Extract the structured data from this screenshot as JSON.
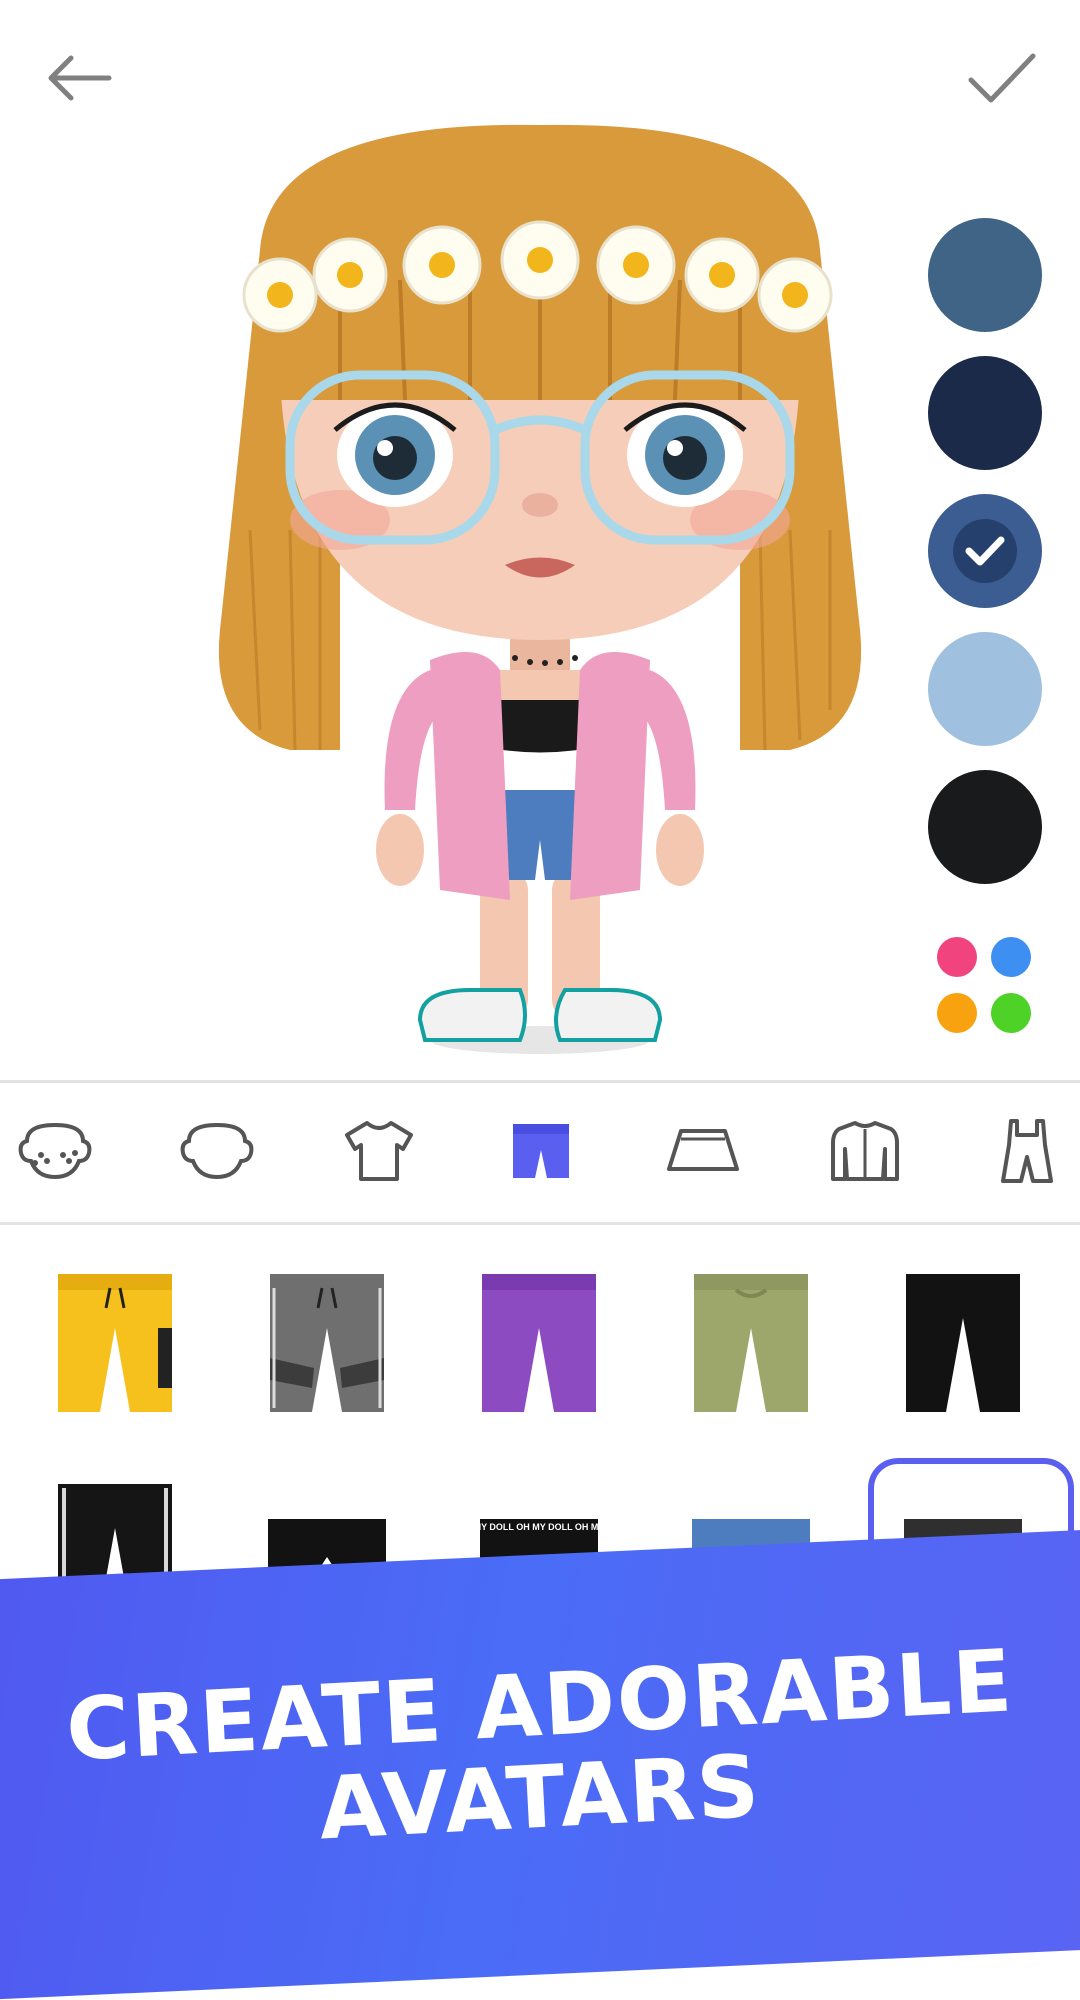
{
  "header": {
    "back_icon": "arrow-left-icon",
    "confirm_icon": "check-icon"
  },
  "colors": {
    "swatches": [
      "#3f6486",
      "#1b2a48",
      "#3c5d92",
      "#9fc0de",
      "#191a1b"
    ],
    "selected_index": 2,
    "more_colors_dots": [
      "#f1447e",
      "#3e8ff2",
      "#f8a20f",
      "#4ed228"
    ]
  },
  "categories": [
    {
      "icon": "face-freckles-icon",
      "active": false
    },
    {
      "icon": "face-icon",
      "active": false
    },
    {
      "icon": "tshirt-icon",
      "active": false
    },
    {
      "icon": "shorts-icon",
      "active": true
    },
    {
      "icon": "skirt-icon",
      "active": false
    },
    {
      "icon": "jacket-icon",
      "active": false
    },
    {
      "icon": "overalls-icon",
      "active": false
    }
  ],
  "items": [
    {
      "name": "yellow-joggers",
      "color": "#f6c11d",
      "selected": false
    },
    {
      "name": "gray-joggers",
      "color": "#6f6f6f",
      "selected": false
    },
    {
      "name": "purple-joggers",
      "color": "#8c4bc0",
      "selected": false
    },
    {
      "name": "olive-pants",
      "color": "#9da66b",
      "selected": false
    },
    {
      "name": "black-pants",
      "color": "#121212",
      "selected": false
    },
    {
      "name": "black-track-pants",
      "color": "#151515",
      "selected": false
    },
    {
      "name": "black-shorts",
      "color": "#121212",
      "selected": false
    },
    {
      "name": "black-logo-shorts",
      "color": "#121212",
      "selected": false
    },
    {
      "name": "denim-shorts",
      "color": "#4d7dbf",
      "selected": false
    },
    {
      "name": "distressed-black-shorts",
      "color": "#2f2f2f",
      "selected": true
    }
  ],
  "logo_shorts_text": "MY DOLL OH MY DOLL OH MY",
  "banner": {
    "line1": "CREATE ADORABLE",
    "line2": "AVATARS",
    "color": "#5159f0"
  },
  "accent": "#5b5ff0"
}
